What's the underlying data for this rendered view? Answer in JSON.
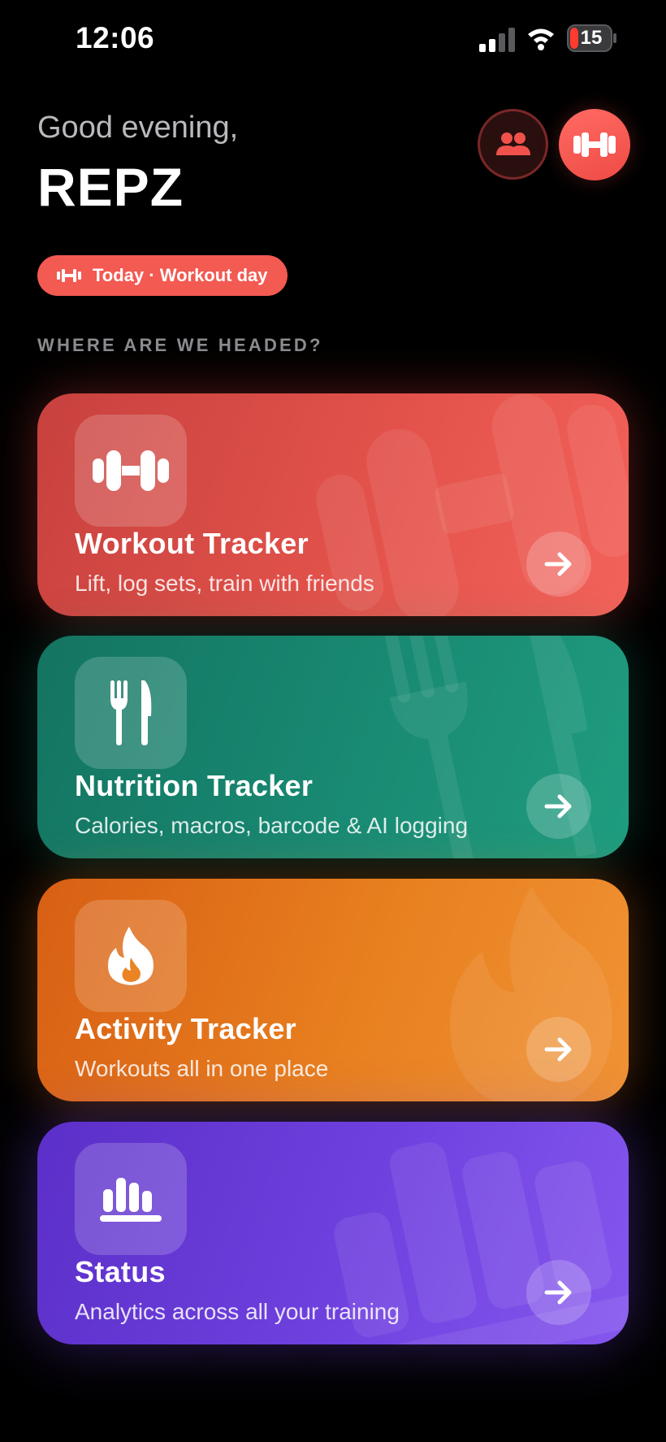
{
  "status_bar": {
    "time": "12:06",
    "battery": "15"
  },
  "header": {
    "greeting": "Good evening,",
    "app_name": "REPZ"
  },
  "today_pill": {
    "label": "Today · Workout day"
  },
  "section_title": "WHERE ARE WE HEADED?",
  "cards": [
    {
      "title": "Workout Tracker",
      "subtitle": "Lift, log sets, train with friends",
      "icon": "dumbbell-icon",
      "color": "#e2524b"
    },
    {
      "title": "Nutrition Tracker",
      "subtitle": "Calories, macros, barcode & AI logging",
      "icon": "fork-knife-icon",
      "color": "#198a73"
    },
    {
      "title": "Activity Tracker",
      "subtitle": "Workouts all in one place",
      "icon": "flame-icon",
      "color": "#e8801f"
    },
    {
      "title": "Status",
      "subtitle": "Analytics across all your training",
      "icon": "bar-chart-icon",
      "color": "#6f41df"
    }
  ],
  "colors": {
    "accent": "#f25a52",
    "background": "#000000"
  }
}
